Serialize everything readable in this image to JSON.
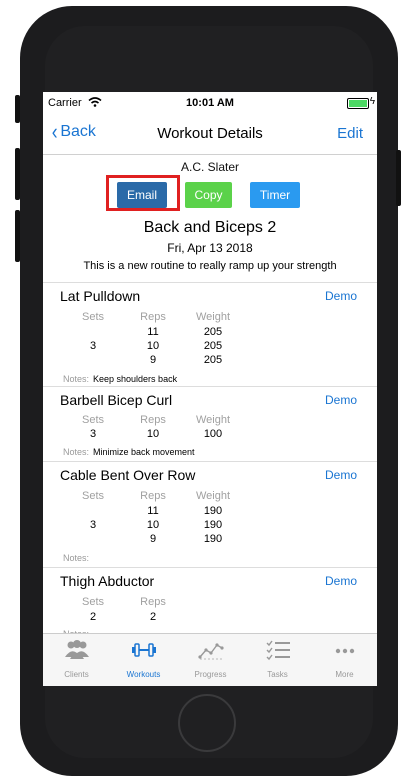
{
  "status": {
    "carrier": "Carrier",
    "time": "10:01 AM",
    "wifi_icon": "wifi-icon",
    "battery_icon": "battery-icon"
  },
  "nav": {
    "back_label": "Back",
    "title": "Workout Details",
    "edit_label": "Edit"
  },
  "client_name": "A.C. Slater",
  "actions": {
    "email": "Email",
    "copy": "Copy",
    "timer": "Timer"
  },
  "workout": {
    "title": "Back and Biceps 2",
    "date": "Fri, Apr 13 2018",
    "description": "This is a new routine to really ramp up your strength"
  },
  "labels": {
    "sets": "Sets",
    "reps": "Reps",
    "weight": "Weight",
    "notes": "Notes:",
    "demo": "Demo"
  },
  "exercises": [
    {
      "name": "Lat Pulldown",
      "sets": "3",
      "reps": [
        "11",
        "10",
        "9"
      ],
      "weight": [
        "205",
        "205",
        "205"
      ],
      "notes": "Keep shoulders back"
    },
    {
      "name": "Barbell Bicep Curl",
      "sets": "3",
      "reps": [
        "10"
      ],
      "weight": [
        "100"
      ],
      "notes": "Minimize back movement"
    },
    {
      "name": "Cable Bent Over Row",
      "sets": "3",
      "reps": [
        "11",
        "10",
        "9"
      ],
      "weight": [
        "190",
        "190",
        "190"
      ],
      "notes": ""
    },
    {
      "name": "Thigh Abductor",
      "sets": "2",
      "reps": [
        "2"
      ],
      "weight": [],
      "notes": ""
    }
  ],
  "tabs": [
    {
      "label": "Clients",
      "icon": "clients-icon"
    },
    {
      "label": "Workouts",
      "icon": "dumbbell-icon",
      "active": true
    },
    {
      "label": "Progress",
      "icon": "progress-icon"
    },
    {
      "label": "Tasks",
      "icon": "tasks-icon"
    },
    {
      "label": "More",
      "icon": "more-icon"
    }
  ],
  "colors": {
    "accent": "#1a75d2",
    "email_button": "#2a6aa8",
    "copy_button": "#5bd24a",
    "timer_button": "#2a9af0",
    "highlight": "#e02020"
  }
}
